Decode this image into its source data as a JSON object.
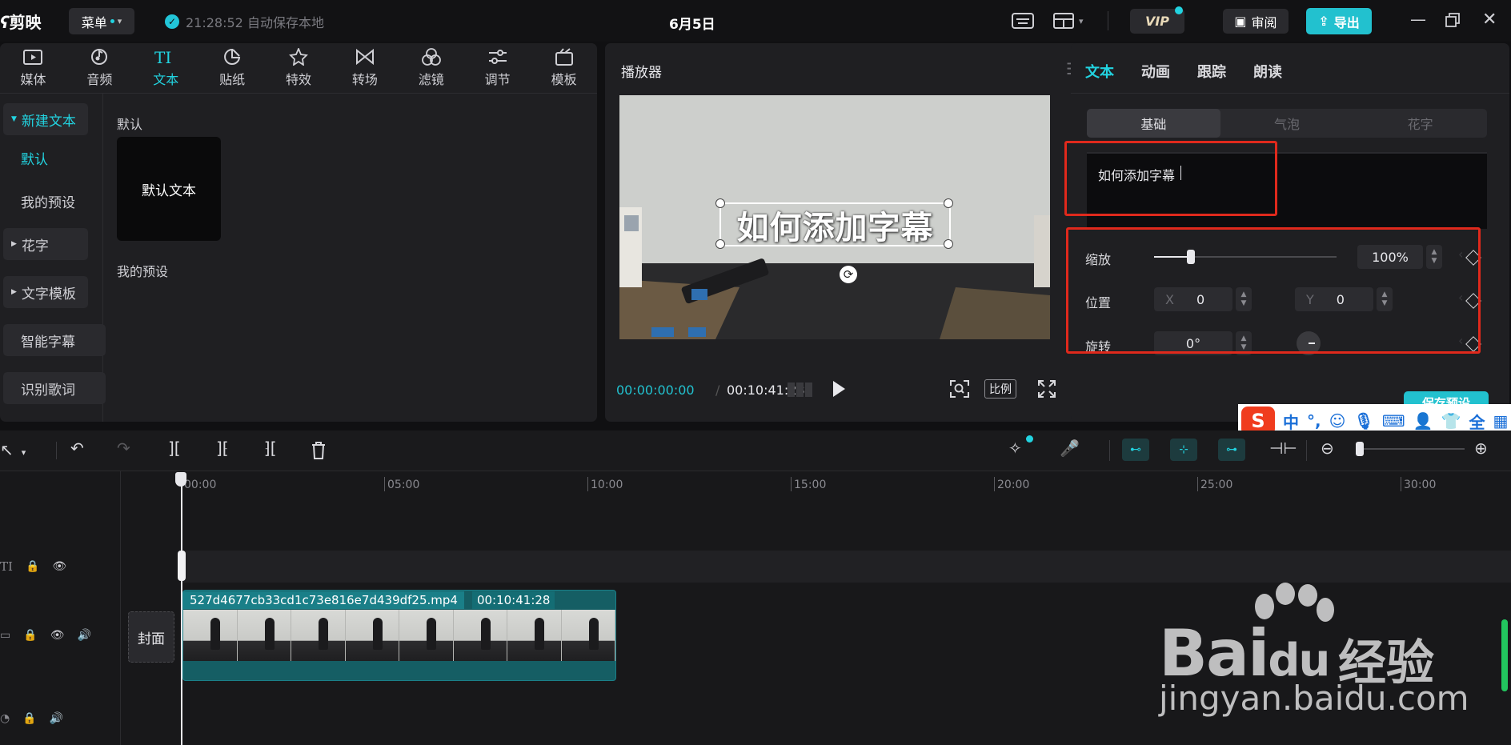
{
  "app": {
    "logo": "剪映",
    "menu_label": "菜单",
    "save_status": "21:28:52 自动保存本地",
    "project_title": "6月5日",
    "vip_label": "VIP",
    "review_label": "审阅",
    "export_label": "导出"
  },
  "colors": {
    "accent": "#22d3e0",
    "export": "#22c1cf",
    "highlight_box": "#e0291c",
    "clip": "#155e64"
  },
  "tool_tabs": [
    {
      "label": "媒体",
      "icon": "media-icon"
    },
    {
      "label": "音频",
      "icon": "audio-icon"
    },
    {
      "label": "文本",
      "icon": "text-icon",
      "active": true
    },
    {
      "label": "贴纸",
      "icon": "sticker-icon"
    },
    {
      "label": "特效",
      "icon": "effects-icon"
    },
    {
      "label": "转场",
      "icon": "transition-icon"
    },
    {
      "label": "滤镜",
      "icon": "filter-icon"
    },
    {
      "label": "调节",
      "icon": "adjust-icon"
    },
    {
      "label": "模板",
      "icon": "template-icon"
    }
  ],
  "side_nav": {
    "new_text": "新建文本",
    "default": "默认",
    "my_presets": "我的预设",
    "fancy_text": "花字",
    "text_templates": "文字模板",
    "smart_captions": "智能字幕",
    "lyrics": "识别歌词"
  },
  "content": {
    "section_default": "默认",
    "default_card": "默认文本",
    "section_my_presets": "我的预设"
  },
  "player": {
    "title": "播放器",
    "subtitle_text": "如何添加字幕",
    "current_time": "00:00:00:00",
    "total_time": "00:10:41:28",
    "ratio_label": "比例"
  },
  "properties": {
    "tabs": [
      "文本",
      "动画",
      "跟踪",
      "朗读"
    ],
    "sub_tabs": [
      "基础",
      "气泡",
      "花字"
    ],
    "text_value": "如何添加字幕",
    "scale_label": "缩放",
    "scale_value": "100%",
    "scale_level": 0.2,
    "position_label": "位置",
    "x_axis": "X",
    "x_value": "0",
    "y_axis": "Y",
    "y_value": "0",
    "rotation_label": "旋转",
    "rotation_value": "0°",
    "save_preset": "保存预设"
  },
  "ime": {
    "logo": "S",
    "mode": "中",
    "punct": "°,"
  },
  "timeline": {
    "ruler": [
      "00:00",
      "05:00",
      "10:00",
      "15:00",
      "20:00",
      "25:00",
      "30:00"
    ],
    "cover_label": "封面",
    "clip_name": "527d4677cb33cd1c73e816e7d439df25.mp4",
    "clip_duration": "00:10:41:28"
  },
  "watermark": {
    "brand": "Bai",
    "brand_du": "du",
    "brand_cn": "经验",
    "url": "jingyan.baidu.com"
  }
}
